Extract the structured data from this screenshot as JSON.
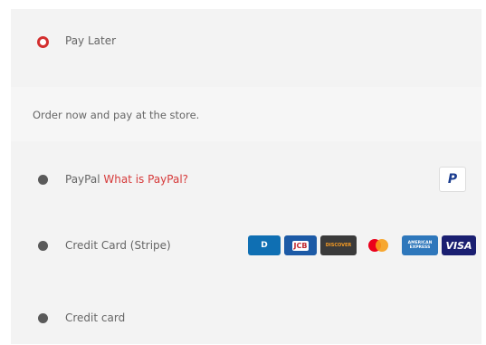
{
  "payment_methods": [
    {
      "label": "Pay Later",
      "selected": true
    },
    {
      "label": "PayPal",
      "link": "What is PayPal?",
      "selected": false
    },
    {
      "label": "Credit Card (Stripe)",
      "selected": false
    },
    {
      "label": "Credit card",
      "selected": false
    }
  ],
  "pay_later_description": "Order now and pay at the store.",
  "logos": {
    "paypal": "P",
    "diners": "D",
    "jcb": "JCB",
    "discover": "DISCOVER",
    "amex": "AMERICAN EXPRESS",
    "visa": "VISA"
  },
  "colors": {
    "accent": "#d32f2f",
    "link": "#d63a3a",
    "panel": "#f3f3f3"
  }
}
